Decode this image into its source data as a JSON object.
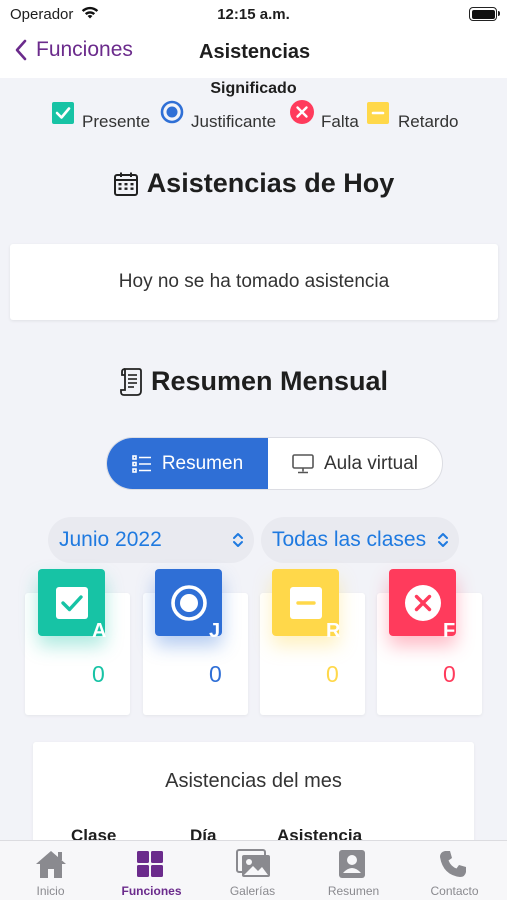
{
  "status_bar": {
    "carrier": "Operador",
    "time": "12:15 a.m."
  },
  "nav": {
    "back_label": "Funciones",
    "title": "Asistencias"
  },
  "legend": {
    "title": "Significado",
    "items": [
      {
        "label": "Presente",
        "icon": "check-square-icon",
        "color": "#17c3a5"
      },
      {
        "label": "Justificante",
        "icon": "radio-icon",
        "color": "#2f6fd6"
      },
      {
        "label": "Falta",
        "icon": "x-circle-icon",
        "color": "#ff3b5c"
      },
      {
        "label": "Retardo",
        "icon": "minus-square-icon",
        "color": "#ffd84a"
      }
    ]
  },
  "today": {
    "title": "Asistencias de Hoy",
    "icon": "calendar-icon",
    "message": "Hoy no se ha tomado asistencia"
  },
  "monthly": {
    "title": "Resumen Mensual",
    "icon": "scroll-icon",
    "segments": [
      {
        "label": "Resumen",
        "icon": "list-icon",
        "active": true
      },
      {
        "label": "Aula virtual",
        "icon": "monitor-icon",
        "active": false
      }
    ],
    "month_picker": "Junio 2022",
    "class_picker": "Todas las clases",
    "stats": [
      {
        "letter": "A",
        "value": "0",
        "color": "#17c3a5",
        "icon": "check-square-icon"
      },
      {
        "letter": "J",
        "value": "0",
        "color": "#2f6fd6",
        "icon": "radio-icon"
      },
      {
        "letter": "R",
        "value": "0",
        "color": "#ffd84a",
        "icon": "minus-square-icon"
      },
      {
        "letter": "F",
        "value": "0",
        "color": "#ff3b5c",
        "icon": "x-circle-icon"
      }
    ]
  },
  "month_table": {
    "title": "Asistencias del mes",
    "columns": [
      "Clase",
      "Día",
      "Asistencia"
    ]
  },
  "tabs": [
    {
      "label": "Inicio",
      "icon": "home-icon",
      "active": false
    },
    {
      "label": "Funciones",
      "icon": "grid-icon",
      "active": true
    },
    {
      "label": "Galerías",
      "icon": "gallery-icon",
      "active": false
    },
    {
      "label": "Resumen",
      "icon": "person-card-icon",
      "active": false
    },
    {
      "label": "Contacto",
      "icon": "phone-icon",
      "active": false
    }
  ],
  "accent_color": "#6b2b8c"
}
